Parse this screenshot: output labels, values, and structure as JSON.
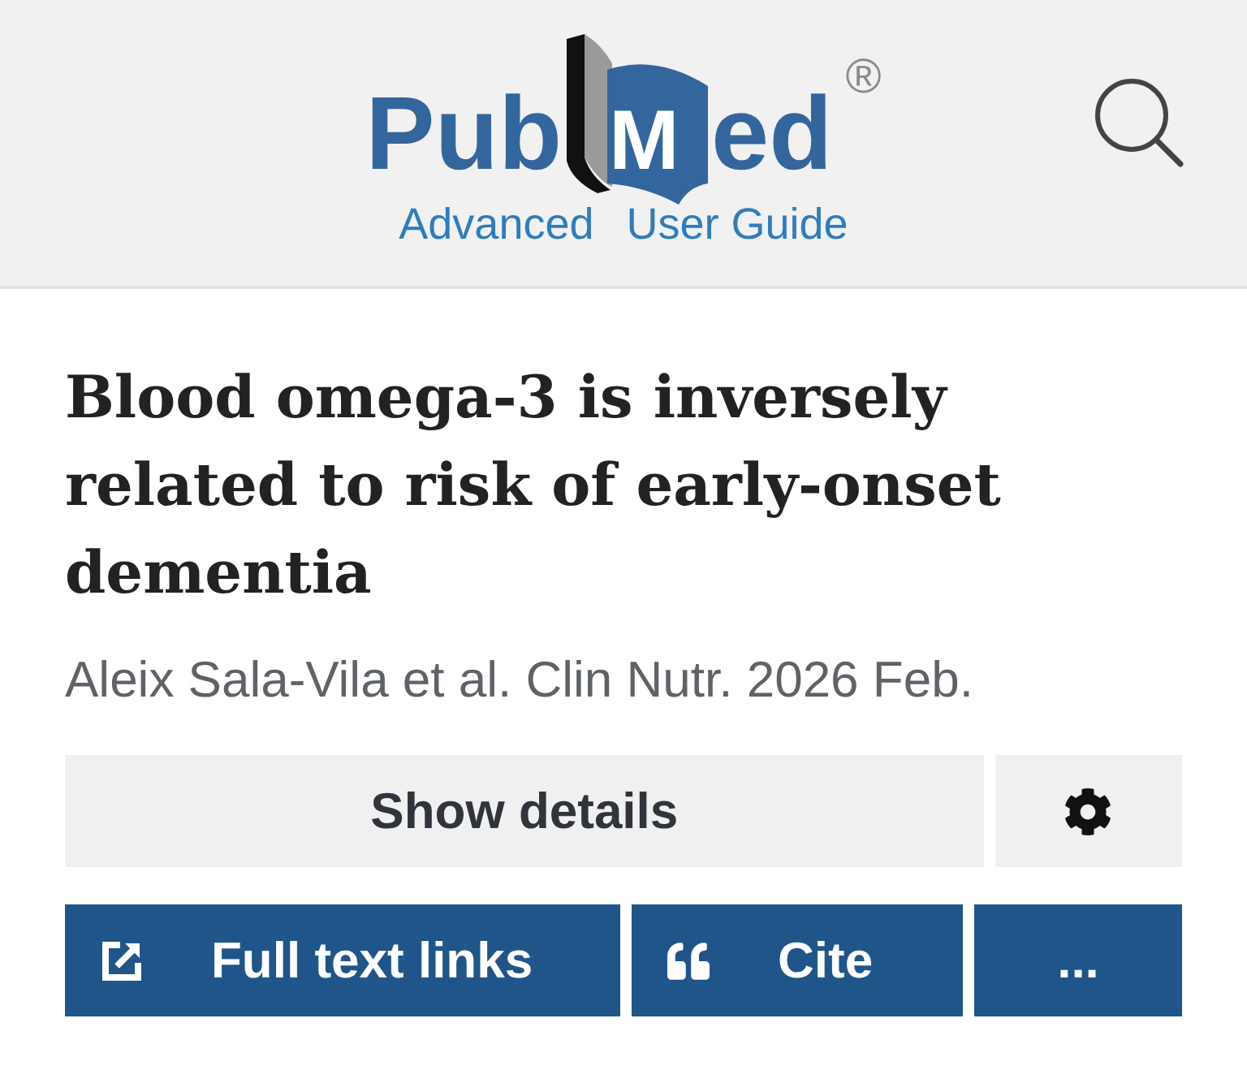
{
  "header": {
    "logo": {
      "text_before": "Pub",
      "emblem_letter": "M",
      "text_after": "ed",
      "registered_mark": "®"
    },
    "links": [
      {
        "label": "Advanced"
      },
      {
        "label": "User Guide"
      }
    ]
  },
  "article": {
    "title": "Blood omega-3 is inversely related to risk of early-onset dementia",
    "citation": "Aleix Sala-Vila et al. Clin Nutr. 2026 Feb."
  },
  "action_rows": [
    {
      "kind": "secondary",
      "buttons": [
        {
          "kind": "details",
          "label": "Show details"
        },
        {
          "kind": "settings"
        }
      ]
    },
    {
      "kind": "primary",
      "buttons": [
        {
          "kind": "full_text",
          "label": "Full text links"
        },
        {
          "kind": "cite",
          "label": "Cite"
        },
        {
          "kind": "more",
          "label": "..."
        }
      ]
    }
  ]
}
